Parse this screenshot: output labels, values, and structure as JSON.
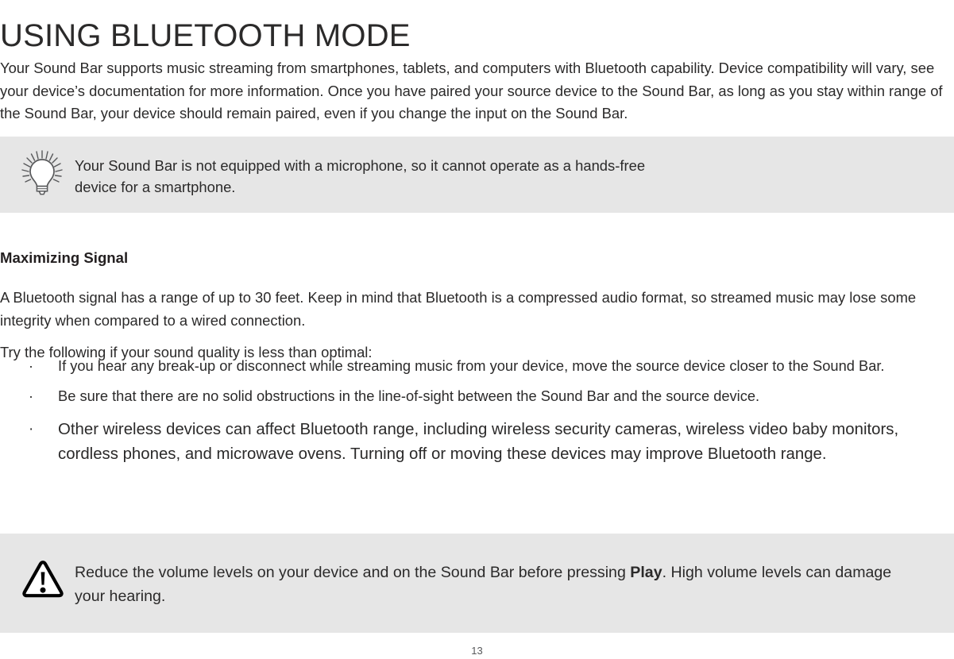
{
  "document": {
    "title": "USING BLUETOOTH MODE",
    "page_number": "13"
  },
  "intro": {
    "text": "Your Sound Bar supports music streaming from smartphones, tablets, and computers with Bluetooth capability. Device compatibility will vary, see your device’s documentation for more information. Once you have paired your source device to the Sound Bar, as long as you stay within range of the Sound Bar, your device should remain paired, even if you change the input on the Sound Bar."
  },
  "tip_callout": {
    "icon": "lightbulb-icon",
    "line1": "Your Sound Bar is not equipped with a microphone, so it cannot operate as a hands-free",
    "line2": "device for a smartphone.",
    "background_color": "#e6e6e6"
  },
  "section": {
    "heading": "Maximizing Signal",
    "paragraph_1": "A Bluetooth signal has a range of up to 30 feet.  Keep in mind that Bluetooth is a compressed audio format, so streamed music may lose some integrity when compared to a wired connection.",
    "paragraph_2": "Try the following if your sound quality is less than optimal:"
  },
  "bullets": {
    "marker": "·",
    "items": [
      "If you hear any break-up or disconnect while streaming music from your device, move the source device closer to the Sound Bar.",
      "Be sure that there are no solid obstructions in the line-of-sight between the Sound Bar and the source device.",
      "Other wireless devices can affect Bluetooth range, including wireless security cameras, wireless video baby monitors, cordless phones, and microwave ovens.  Turning off or moving these devices may improve Bluetooth range."
    ]
  },
  "warning_callout": {
    "icon": "warning-triangle-icon",
    "text_before": "Reduce the volume levels on your device and on the Sound Bar before pressing ",
    "emphasis": "Play",
    "text_after": ". High volume levels can damage your hearing.",
    "background_color": "#e6e6e6"
  }
}
